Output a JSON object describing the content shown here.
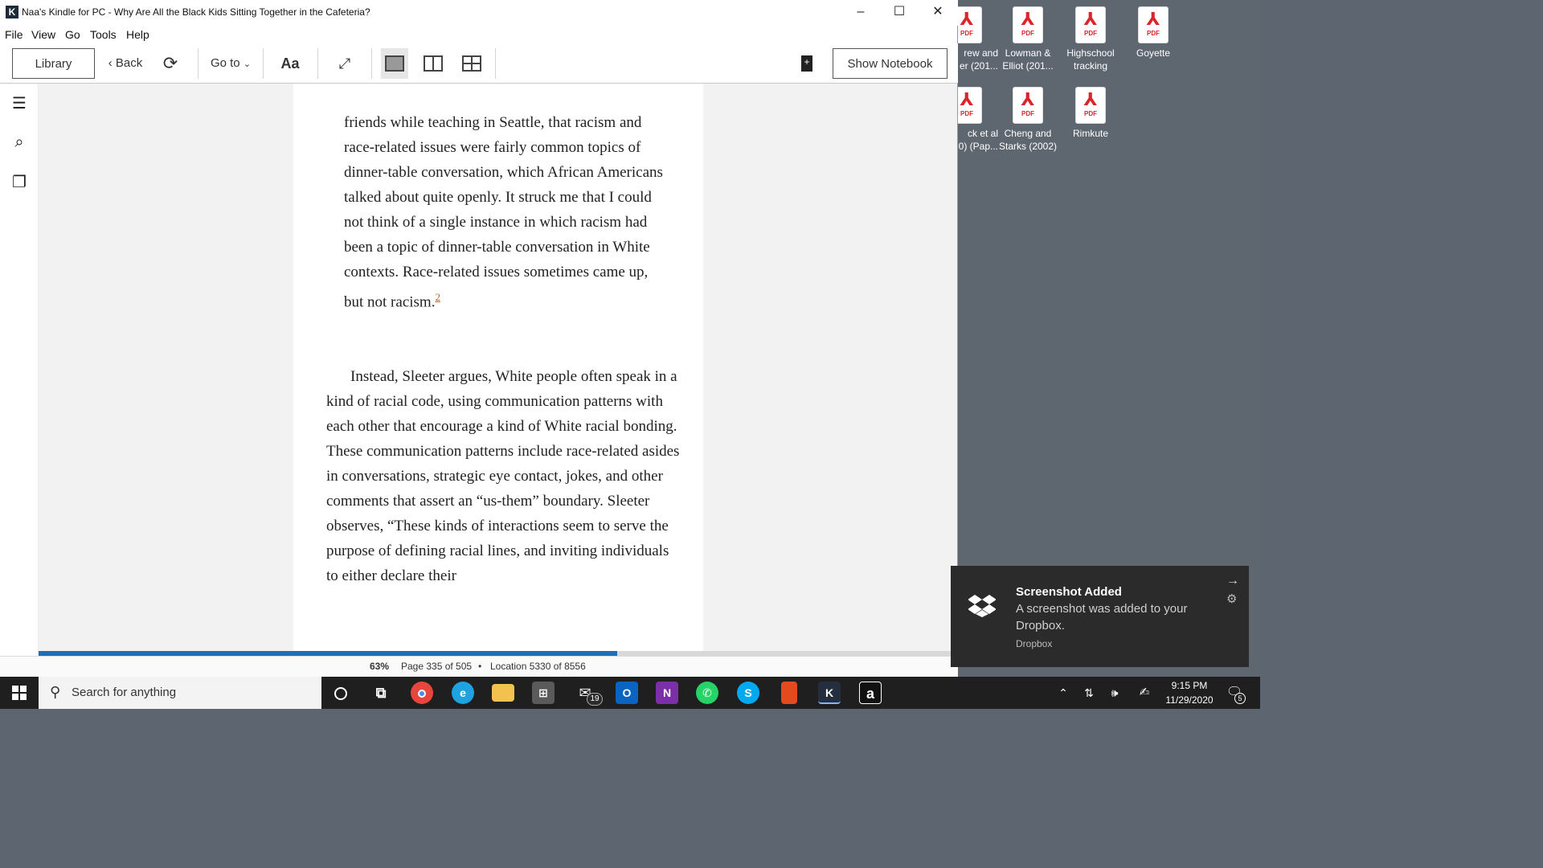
{
  "window": {
    "title": "Naa's Kindle for PC - Why Are All the Black Kids Sitting Together in the Cafeteria?",
    "controls": {
      "minimize": "–",
      "maximize": "☐",
      "close": "✕"
    }
  },
  "menu": [
    "File",
    "View",
    "Go",
    "Tools",
    "Help"
  ],
  "toolbar": {
    "library": "Library",
    "back": "Back",
    "goto": "Go to",
    "font": "Aa",
    "show_notebook": "Show Notebook"
  },
  "book": {
    "quote": "friends while teaching in Seattle, that racism and race-related issues were fairly common topics of dinner-table conversation, which African Americans talked about quite openly. It struck me that I could not think of a single instance in which racism had been a topic of dinner-table conversation in White contexts. Race-related issues sometimes came up, but not racism.",
    "footnote": "2",
    "paragraph": "Instead, Sleeter argues, White people often speak in a kind of racial code, using communication patterns with each other that encourage a kind of White racial bonding. These communication patterns include race-related asides in conversations, strategic eye contact, jokes, and other comments that assert an “us-them” boundary. Sleeter observes, “These kinds of interactions seem to serve the purpose of defining racial lines, and inviting individuals to either declare their"
  },
  "status": {
    "progress_label": "63%",
    "progress_fraction": 0.63,
    "page": "Page 335 of 505",
    "separator": "•",
    "location": "Location 5330 of 8556"
  },
  "desktop_icons": [
    {
      "line1": "rew and",
      "line2": "er (201..."
    },
    {
      "line1": "Lowman &",
      "line2": "Elliot (201..."
    },
    {
      "line1": "Highschool",
      "line2": "tracking"
    },
    {
      "line1": "Goyette",
      "line2": ""
    },
    {
      "line1": "ck et al",
      "line2": "0) (Pap..."
    },
    {
      "line1": "Cheng and",
      "line2": "Starks (2002)"
    },
    {
      "line1": "Rimkute",
      "line2": ""
    }
  ],
  "pdf_tag": "PDF",
  "toast": {
    "title": "Screenshot Added",
    "body": "A screenshot was added to your Dropbox.",
    "source": "Dropbox"
  },
  "taskbar": {
    "search_placeholder": "Search for anything",
    "mail_badge": "19",
    "onenote": "N",
    "outlook": "O",
    "skype": "S",
    "amazon": "a",
    "time": "9:15 PM",
    "date": "11/29/2020",
    "notifications": "5",
    "colors": {
      "chrome": "#e8453c",
      "edge": "#1fa3e0",
      "explorer": "#f2c14e",
      "store": "#5a5a5a",
      "outlook": "#0a64c2",
      "onenote": "#7b2fa8",
      "whatsapp": "#25d366",
      "skype": "#00a9f0",
      "office": "#e34a1e",
      "kindle": "#232f3e",
      "amazon": "#111111"
    }
  }
}
